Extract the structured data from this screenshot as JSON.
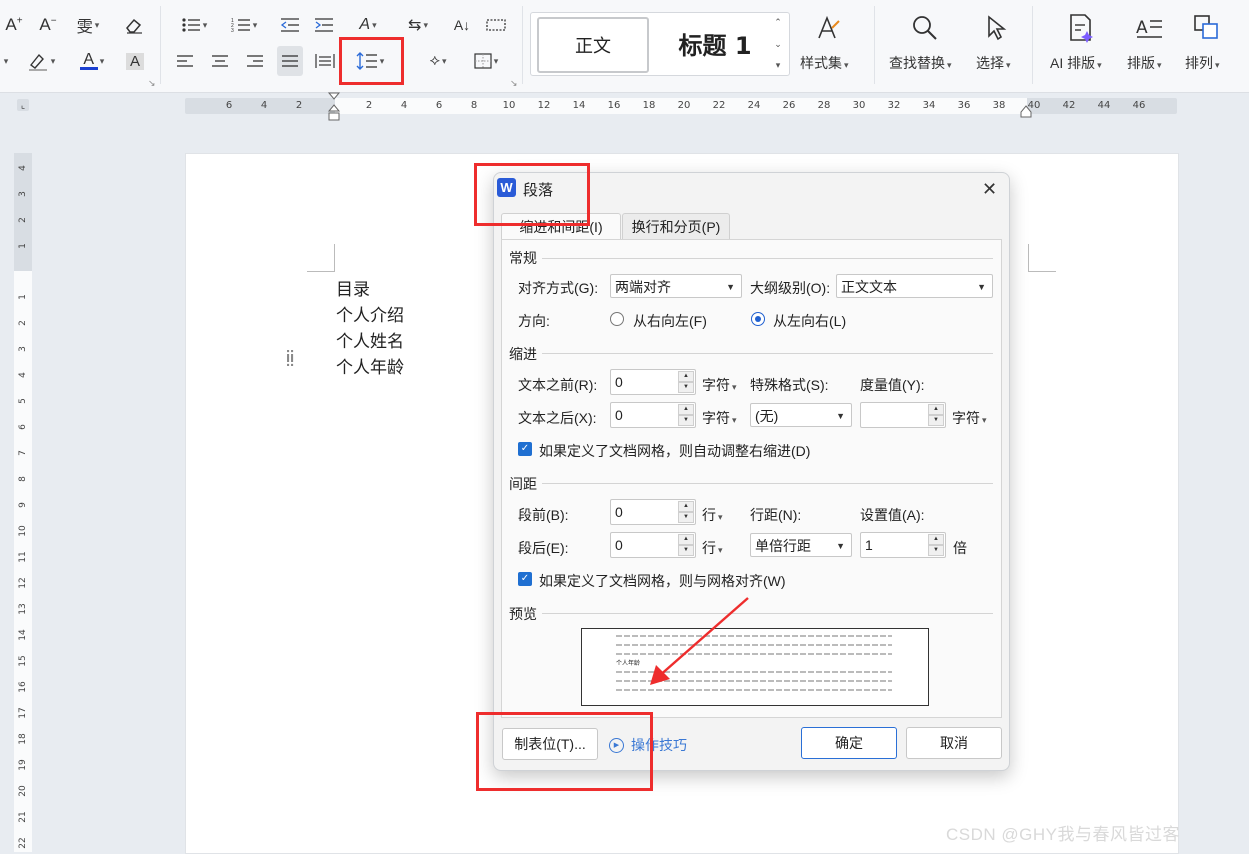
{
  "ribbon": {
    "style_gallery": {
      "normal": "正文",
      "heading1": "标题 1"
    },
    "buttons": {
      "style_set": "样式集",
      "find_replace": "查找替换",
      "select": "选择",
      "ai_layout": "AI 排版",
      "layout": "排版",
      "arrange": "排列"
    },
    "icons": [
      "font-grow-icon",
      "font-shrink-icon",
      "phonetic-guide-icon",
      "clear-format-icon",
      "bullets-icon",
      "numbering-icon",
      "decrease-indent-icon",
      "increase-indent-icon",
      "text-direction-icon",
      "sort-icon",
      "distributed-icon",
      "highlight-icon",
      "font-color-icon",
      "char-shading-icon",
      "align-left-icon",
      "align-center-icon",
      "align-right-icon",
      "justify-icon",
      "distribute-align-icon",
      "line-spacing-icon",
      "shading-icon",
      "borders-icon"
    ],
    "font_color": "#1a3fd1"
  },
  "ruler": {
    "marks": [
      "6",
      "4",
      "2",
      "2",
      "4",
      "6",
      "8",
      "10",
      "12",
      "14",
      "16",
      "18",
      "20",
      "22",
      "24",
      "26",
      "28",
      "30",
      "32",
      "34",
      "36",
      "38",
      "40",
      "42",
      "44",
      "46"
    ],
    "vmarks_top": [
      "4",
      "3",
      "2",
      "1"
    ],
    "vmarks": [
      "1",
      "2",
      "3",
      "4",
      "5",
      "6",
      "7",
      "8",
      "9",
      "10",
      "11",
      "12",
      "13",
      "14",
      "15",
      "16",
      "17",
      "18",
      "19",
      "20",
      "21",
      "22"
    ]
  },
  "document": {
    "lines": [
      "目录",
      "个人介绍",
      "个人姓名",
      "个人年龄"
    ]
  },
  "dialog": {
    "title": "段落",
    "app_icon_letter": "W",
    "tabs": [
      "缩进和间距(I)",
      "换行和分页(P)"
    ],
    "general": {
      "section": "常规",
      "alignment_label": "对齐方式(G):",
      "alignment_value": "两端对齐",
      "outline_label": "大纲级别(O):",
      "outline_value": "正文文本",
      "direction_label": "方向:",
      "rtl_label": "从右向左(F)",
      "ltr_label": "从左向右(L)"
    },
    "indent": {
      "section": "缩进",
      "before_label": "文本之前(R):",
      "before_value": "0",
      "before_unit": "字符",
      "after_label": "文本之后(X):",
      "after_value": "0",
      "after_unit": "字符",
      "special_label": "特殊格式(S):",
      "special_value": "(无)",
      "measure_label": "度量值(Y):",
      "measure_value": "",
      "measure_unit": "字符",
      "auto_adjust_label": "如果定义了文档网格，则自动调整右缩进(D)"
    },
    "spacing": {
      "section": "间距",
      "before_label": "段前(B):",
      "before_value": "0",
      "before_unit": "行",
      "after_label": "段后(E):",
      "after_value": "0",
      "after_unit": "行",
      "line_label": "行距(N):",
      "line_value": "单倍行距",
      "setting_label": "设置值(A):",
      "setting_value": "1",
      "setting_unit": "倍",
      "snap_grid_label": "如果定义了文档网格，则与网格对齐(W)"
    },
    "preview": {
      "section": "预览",
      "sample_label": "个人年龄"
    },
    "footer": {
      "tabs_button": "制表位(T)...",
      "tips_link": "操作技巧",
      "ok": "确定",
      "cancel": "取消"
    }
  },
  "annotation": {
    "color": "#ee2d2d"
  },
  "watermark": "CSDN @GHY我与春风皆过客"
}
